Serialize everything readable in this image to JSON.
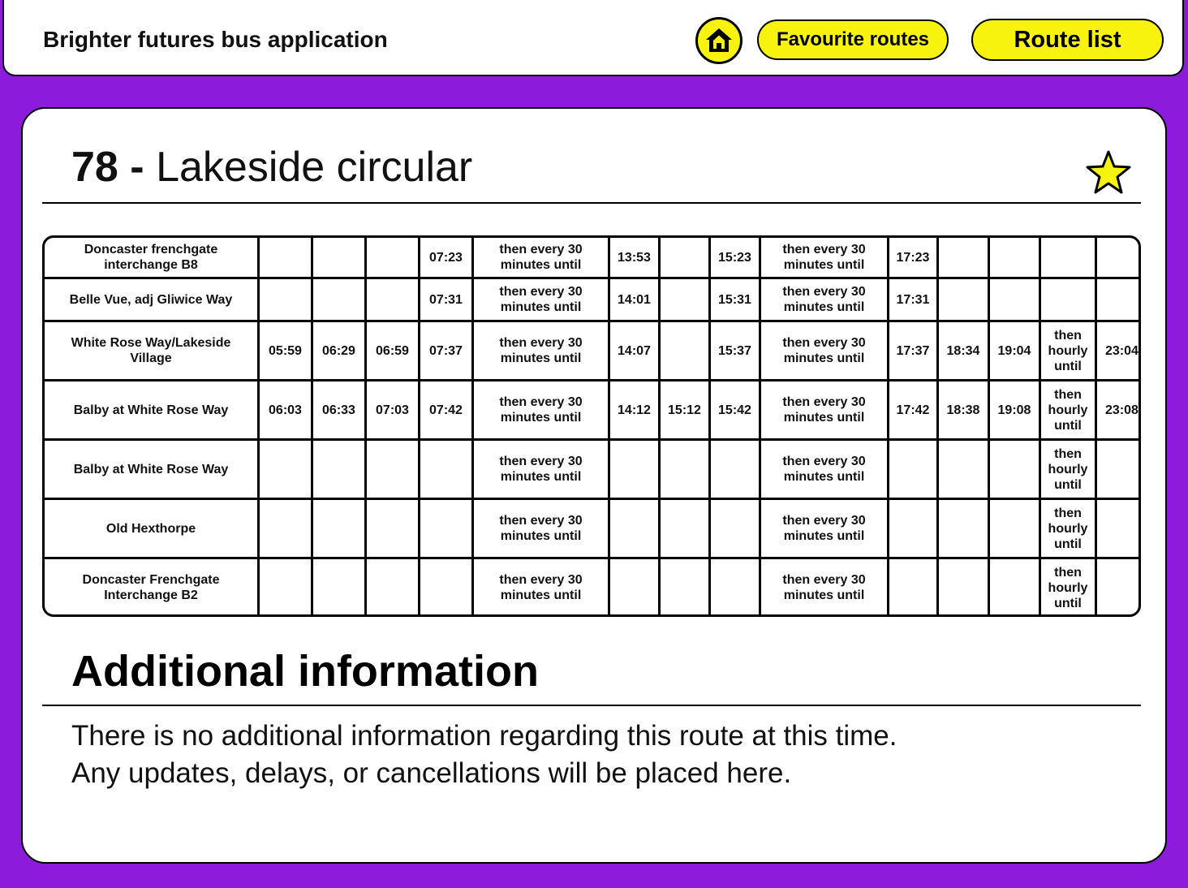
{
  "header": {
    "app_title": "Brighter futures bus application",
    "home_icon": "home-icon",
    "favourite_label": "Favourite routes",
    "route_list_label": "Route list"
  },
  "route": {
    "number": "78 -",
    "name": "Lakeside circular",
    "favourite_icon": "star-icon",
    "favourite_color": "#f8f20f"
  },
  "timetable": {
    "rows": [
      {
        "stop": "Doncaster frenchgate interchange B8",
        "cells": [
          "",
          "",
          "",
          "07:23",
          "then every 30 minutes until",
          "13:53",
          "",
          "15:23",
          "then every 30 minutes until",
          "17:23",
          "",
          "",
          "",
          ""
        ]
      },
      {
        "stop": "Belle Vue, adj Gliwice Way",
        "cells": [
          "",
          "",
          "",
          "07:31",
          "then every 30 minutes until",
          "14:01",
          "",
          "15:31",
          "then every 30 minutes until",
          "17:31",
          "",
          "",
          "",
          ""
        ]
      },
      {
        "stop": "White Rose Way/Lakeside Village",
        "cells": [
          "05:59",
          "06:29",
          "06:59",
          "07:37",
          "then every 30 minutes until",
          "14:07",
          "",
          "15:37",
          "then every 30 minutes until",
          "17:37",
          "18:34",
          "19:04",
          "then hourly until",
          "23:04"
        ]
      },
      {
        "stop": "Balby at White Rose Way",
        "cells": [
          "06:03",
          "06:33",
          "07:03",
          "07:42",
          "then every 30 minutes until",
          "14:12",
          "15:12",
          "15:42",
          "then every 30 minutes until",
          "17:42",
          "18:38",
          "19:08",
          "then hourly until",
          "23:08"
        ]
      },
      {
        "stop": "Balby at White Rose Way",
        "cells": [
          "",
          "",
          "",
          "",
          "then every 30 minutes until",
          "",
          "",
          "",
          "then every 30 minutes until",
          "",
          "",
          "",
          "then hourly until",
          ""
        ]
      },
      {
        "stop": "Old Hexthorpe",
        "cells": [
          "",
          "",
          "",
          "",
          "then every 30 minutes until",
          "",
          "",
          "",
          "then every 30 minutes until",
          "",
          "",
          "",
          "then hourly until",
          ""
        ]
      },
      {
        "stop": "Doncaster Frenchgate Interchange B2",
        "cells": [
          "",
          "",
          "",
          "",
          "then every 30 minutes until",
          "",
          "",
          "",
          "then every 30 minutes until",
          "",
          "",
          "",
          "then hourly until",
          ""
        ]
      }
    ]
  },
  "additional": {
    "heading": "Additional information",
    "line1": "There is no additional information regarding this route at this time.",
    "line2": "Any updates, delays, or cancellations will be placed here."
  },
  "colors": {
    "background": "#8c1bdc",
    "accent": "#f8f20f"
  }
}
